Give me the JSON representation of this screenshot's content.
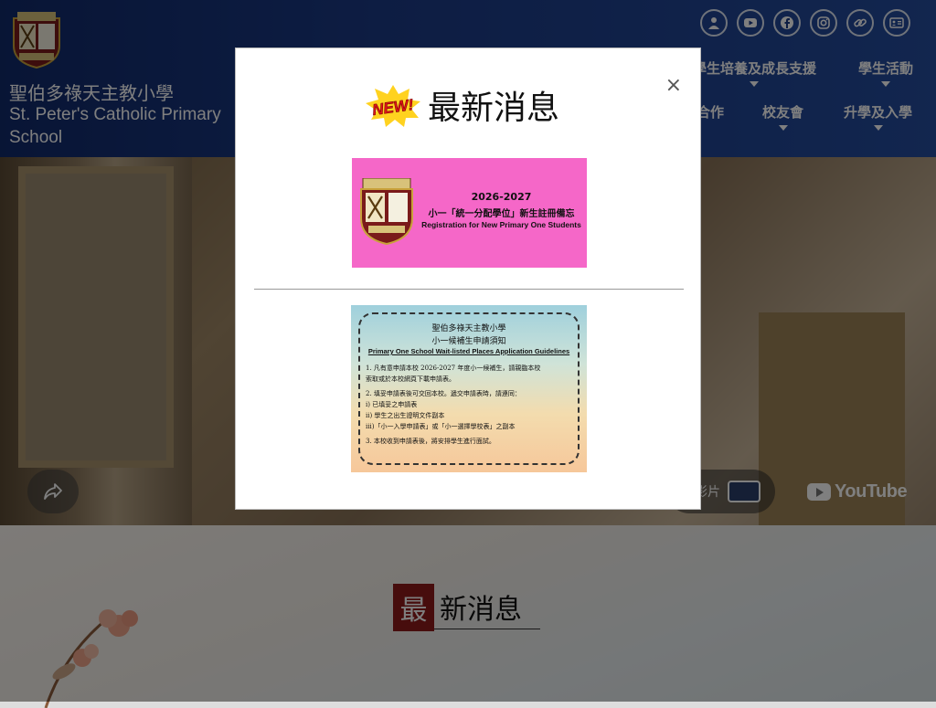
{
  "school": {
    "name_zh": "聖伯多祿天主教小學",
    "name_en": "St. Peter's Catholic Primary School"
  },
  "social_icons": [
    "user-icon",
    "youtube-icon",
    "facebook-icon",
    "instagram-icon",
    "link-icon",
    "card-icon"
  ],
  "nav": {
    "row1": [
      "學生培養及成長支援",
      "學生活動"
    ],
    "row2": [
      "合作",
      "校友會",
      "升學及入學"
    ]
  },
  "hero": {
    "watch_label": "影片",
    "youtube_label": "YouTube"
  },
  "section": {
    "news_first_char": "最",
    "news_rest": "新消息"
  },
  "modal": {
    "close_label": "×",
    "badge_text": "NEW!",
    "heading": "最新消息",
    "banner1": {
      "line1": "2026-2027",
      "line2": "小一「統一分配學位」新生註冊備忘",
      "line3": "Registration for New Primary One Students"
    },
    "banner2": {
      "title1": "聖伯多祿天主教小學",
      "title2": "小一候補生申請須知",
      "title3": "Primary One School Wait-listed Places Application Guidelines",
      "items": [
        "1. 凡有意申請本校 2026-2027 年度小一候補生，請親臨本校",
        "   索取或於本校網頁下載申請表。",
        "2. 填妥申請表後可交回本校。遞交申請表時，請連同：",
        "   i)   已填妥之申請表",
        "   ii)  學生之出生證明文件副本",
        "   iii)「小一入學申請表」或「小一選擇學校表」之副本",
        "3. 本校收到申請表後，將安排學生進行面試。"
      ]
    }
  },
  "colors": {
    "header": "#1b3a86",
    "banner1_bg": "#f567c8",
    "news_accent": "#8e1b1b"
  }
}
